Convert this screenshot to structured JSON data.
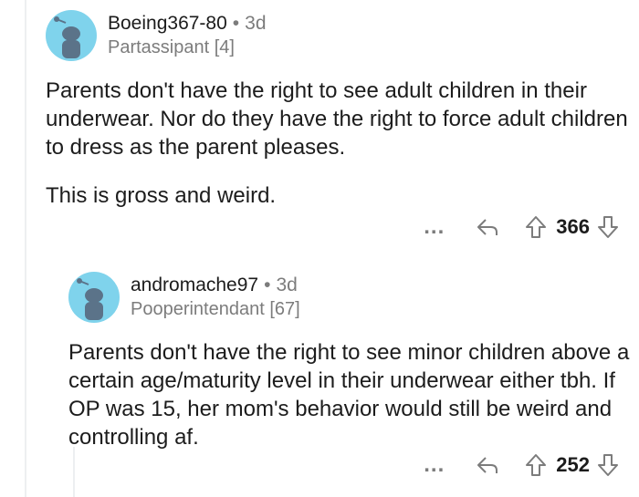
{
  "comments": [
    {
      "username": "Boeing367-80",
      "separator": "•",
      "age": "3d",
      "flair": "Partassipant [4]",
      "paragraphs": [
        "Parents don't have the right to see adult children in their underwear. Nor do they have the right to force adult children to dress as the parent pleases.",
        "This is gross and weird."
      ],
      "more_label": "...",
      "score": "366"
    },
    {
      "username": "andromache97",
      "separator": "•",
      "age": "3d",
      "flair": "Pooperintendant [67]",
      "paragraphs": [
        "Parents don't have the right to see minor children above a certain age/maturity level in their underwear either tbh. If OP was 15, her mom's behavior would still be weird and controlling af."
      ],
      "more_label": "...",
      "score": "252"
    }
  ],
  "colors": {
    "avatar_bg": "#7fd3ec",
    "avatar_figure": "#5b7389",
    "muted": "#7c7c7c",
    "text": "#1c1c1c"
  },
  "icons": [
    "snoo-avatar-icon",
    "reply-arrow-icon",
    "upvote-arrow-icon",
    "downvote-arrow-icon",
    "more-options-icon"
  ]
}
